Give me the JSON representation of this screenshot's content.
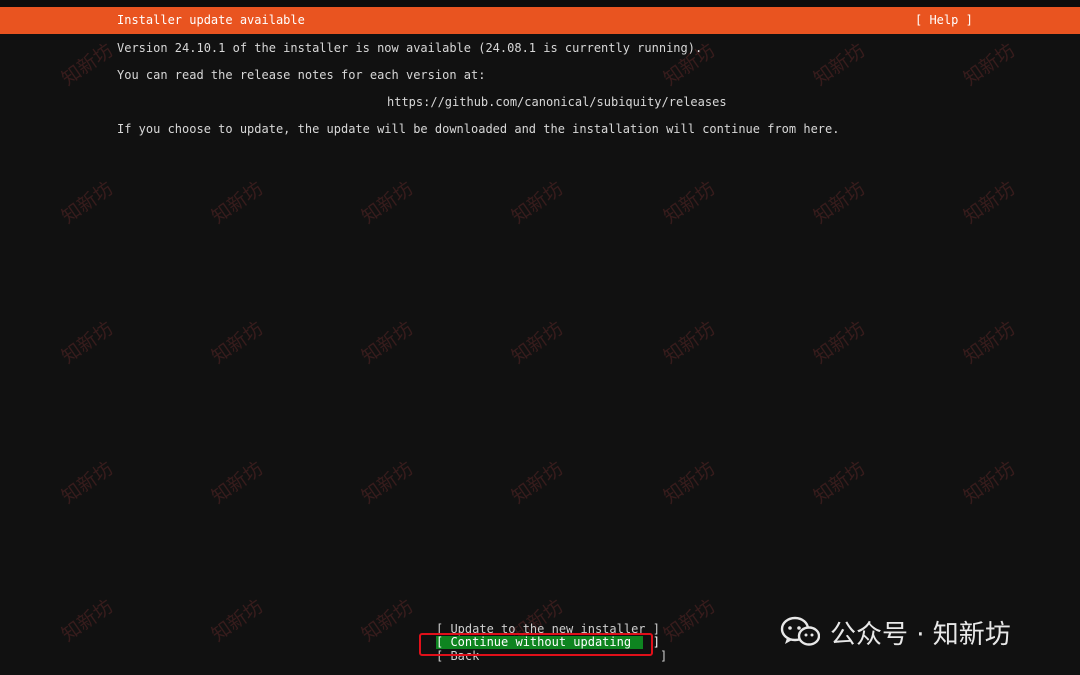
{
  "header": {
    "title": "Installer update available",
    "help_label": "[ Help ]"
  },
  "body": {
    "line1": "Version 24.10.1 of the installer is now available (24.08.1 is currently running).",
    "line2": "You can read the release notes for each version at:",
    "url": "https://github.com/canonical/subiquity/releases",
    "line4": "If you choose to update, the update will be downloaded and the installation will continue from here."
  },
  "buttons": {
    "update": "[ Update to the new installer ]",
    "continue": "[ Continue without updating   ]",
    "back": "[ Back                         ]"
  },
  "watermark": {
    "text": "知新坊"
  },
  "brand": {
    "text": "公众号 · 知新坊"
  },
  "colors": {
    "header_bg": "#e95420",
    "selected_bg": "#0e8420",
    "highlight_border": "#e0101a"
  }
}
